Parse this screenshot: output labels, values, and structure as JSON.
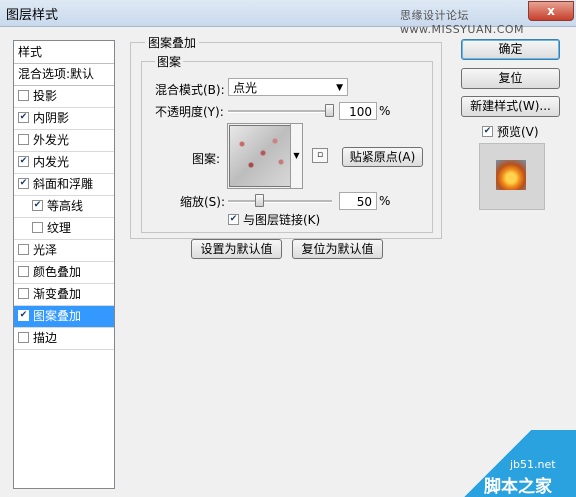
{
  "window": {
    "title": "图层样式",
    "watermark_top": "思缘设计论坛 www.MISSYUAN.COM",
    "close_label": "x"
  },
  "left_panel": {
    "header": "样式",
    "blend_options": "混合选项:默认",
    "items": [
      {
        "label": "投影",
        "checked": false
      },
      {
        "label": "内阴影",
        "checked": true
      },
      {
        "label": "外发光",
        "checked": false
      },
      {
        "label": "内发光",
        "checked": true
      },
      {
        "label": "斜面和浮雕",
        "checked": true
      },
      {
        "label": "等高线",
        "checked": true,
        "indent": true
      },
      {
        "label": "纹理",
        "checked": false,
        "indent": true
      },
      {
        "label": "光泽",
        "checked": false
      },
      {
        "label": "颜色叠加",
        "checked": false
      },
      {
        "label": "渐变叠加",
        "checked": false
      },
      {
        "label": "图案叠加",
        "checked": true,
        "selected": true
      },
      {
        "label": "描边",
        "checked": false
      }
    ]
  },
  "pattern_overlay": {
    "group_title": "图案叠加",
    "inner_title": "图案",
    "blend_mode_label": "混合模式(B):",
    "blend_mode_value": "点光",
    "opacity_label": "不透明度(Y):",
    "opacity_value": "100",
    "opacity_percent": 100,
    "opacity_unit": "%",
    "pattern_label": "图案:",
    "snap_button": "贴紧原点(A)",
    "scale_label": "缩放(S):",
    "scale_value": "50",
    "scale_percent": 50,
    "scale_unit": "%",
    "link_label": "与图层链接(K)",
    "link_checked": true,
    "set_default_button": "设置为默认值",
    "reset_default_button": "复位为默认值"
  },
  "right_panel": {
    "ok_button": "确定",
    "reset_button": "复位",
    "new_style_button": "新建样式(W)...",
    "preview_label": "预览(V)",
    "preview_checked": true
  },
  "watermark_corner": {
    "site": "jb51.net",
    "name": "脚本之家"
  },
  "colors": {
    "selected_row": "#3399ff",
    "corner_watermark": "#2aa2e0"
  }
}
